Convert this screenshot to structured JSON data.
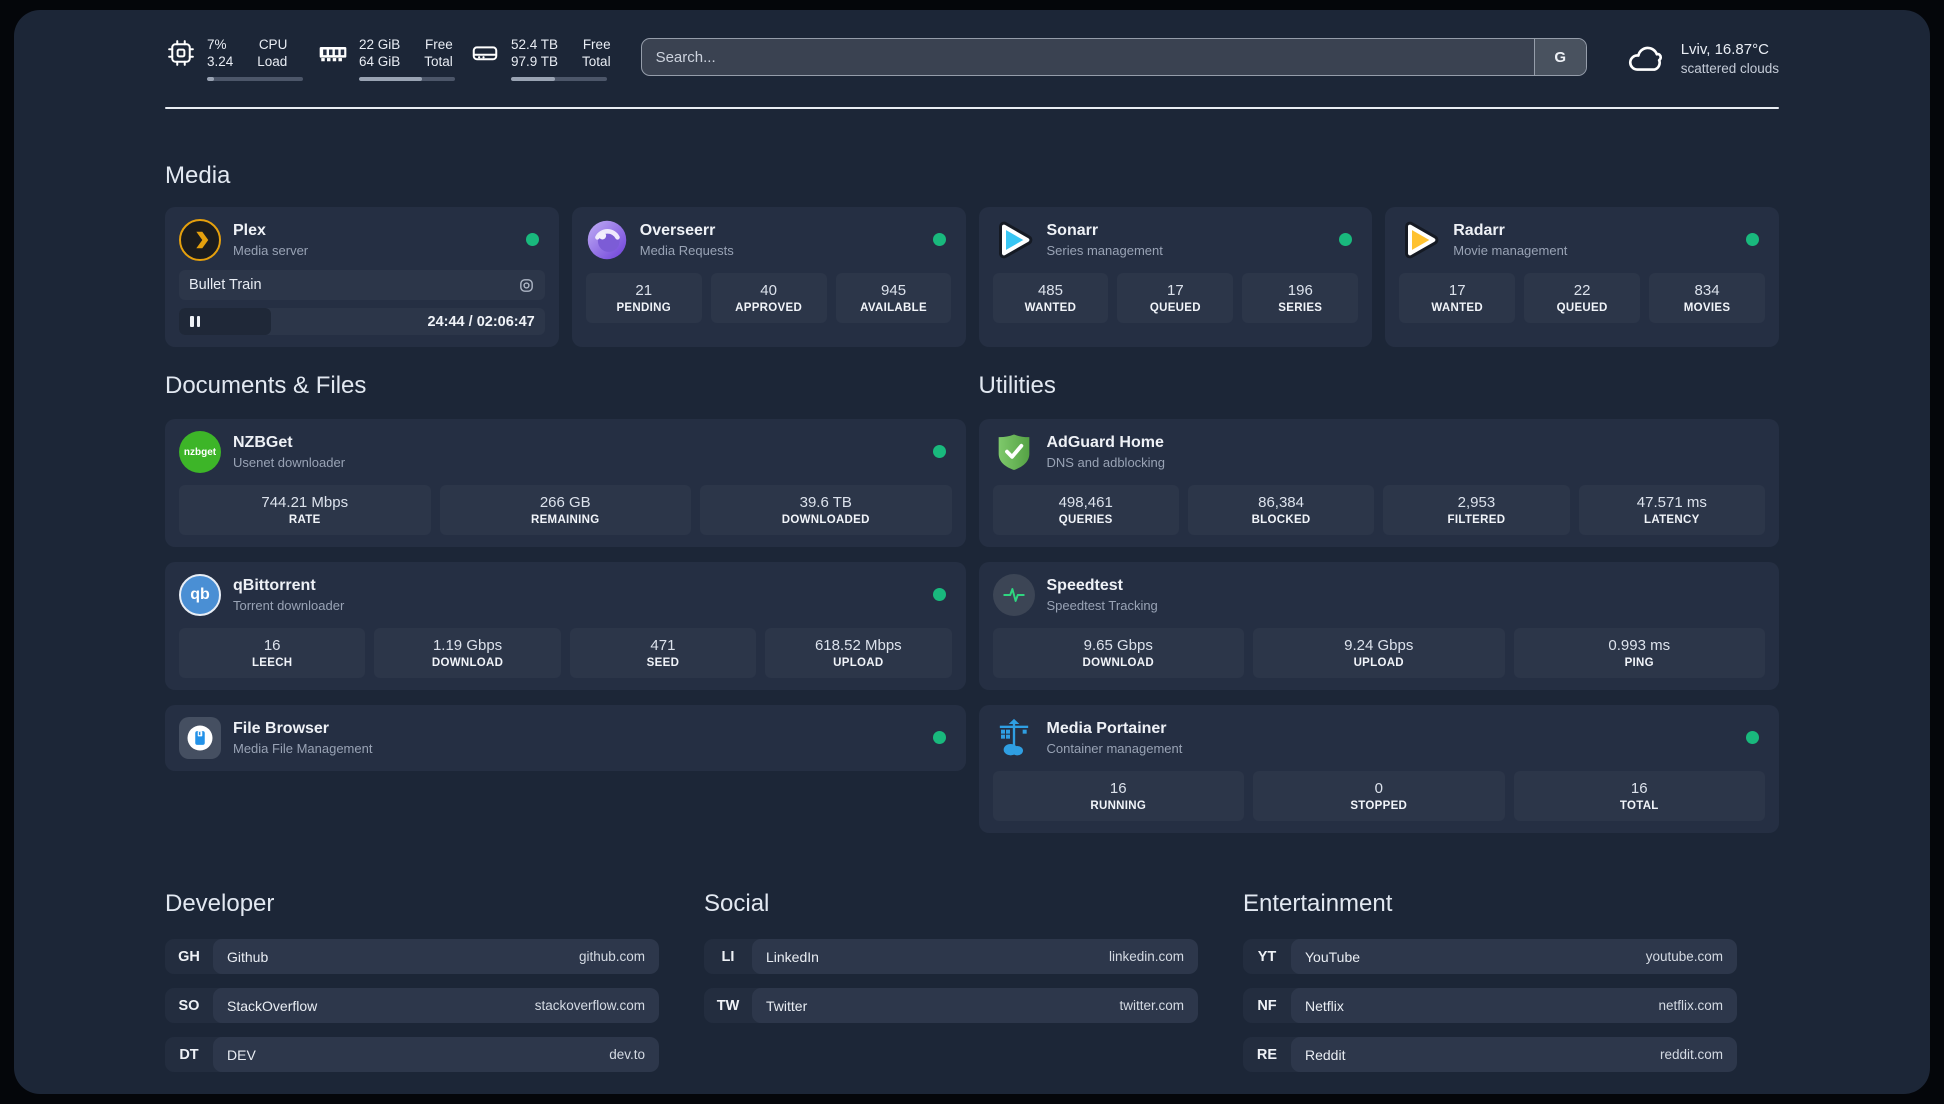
{
  "colors": {
    "status_green": "#19b97d",
    "plex_gold": "#e5a00d",
    "sonarr_blue": "#38c6f4",
    "radarr_gold": "#ffc230",
    "nzbget_green": "#3db528",
    "qbittorrent_blue": "#4a8fd4",
    "adguard_green": "#68b54d",
    "speedtest_green": "#2fd680",
    "portainer_blue": "#2f9fe3"
  },
  "header": {
    "stats": [
      {
        "icon": "cpu-icon",
        "rows": [
          {
            "value": "7%",
            "label": "CPU"
          },
          {
            "value": "3.24",
            "label": "Load"
          }
        ],
        "progress": 7
      },
      {
        "icon": "memory-icon",
        "rows": [
          {
            "value": "22 GiB",
            "label": "Free"
          },
          {
            "value": "64 GiB",
            "label": "Total"
          }
        ],
        "progress": 66
      },
      {
        "icon": "disk-icon",
        "rows": [
          {
            "value": "52.4 TB",
            "label": "Free"
          },
          {
            "value": "97.9 TB",
            "label": "Total"
          }
        ],
        "progress": 46
      }
    ],
    "search": {
      "placeholder": "Search...",
      "button_label": "G"
    },
    "weather": {
      "location": "Lviv, 16.87°C",
      "condition": "scattered clouds"
    }
  },
  "sections": {
    "media": "Media",
    "documents": "Documents & Files",
    "utilities": "Utilities",
    "developer": "Developer",
    "social": "Social",
    "entertainment": "Entertainment"
  },
  "apps": {
    "plex": {
      "name": "Plex",
      "desc": "Media server",
      "now_playing": "Bullet Train",
      "time": "24:44 / 02:06:47"
    },
    "overseerr": {
      "name": "Overseerr",
      "desc": "Media Requests",
      "stats": [
        {
          "value": "21",
          "label": "PENDING"
        },
        {
          "value": "40",
          "label": "APPROVED"
        },
        {
          "value": "945",
          "label": "AVAILABLE"
        }
      ]
    },
    "sonarr": {
      "name": "Sonarr",
      "desc": "Series management",
      "stats": [
        {
          "value": "485",
          "label": "WANTED"
        },
        {
          "value": "17",
          "label": "QUEUED"
        },
        {
          "value": "196",
          "label": "SERIES"
        }
      ]
    },
    "radarr": {
      "name": "Radarr",
      "desc": "Movie management",
      "stats": [
        {
          "value": "17",
          "label": "WANTED"
        },
        {
          "value": "22",
          "label": "QUEUED"
        },
        {
          "value": "834",
          "label": "MOVIES"
        }
      ]
    },
    "nzbget": {
      "name": "NZBGet",
      "desc": "Usenet downloader",
      "icon_text": "nzbget",
      "stats": [
        {
          "value": "744.21 Mbps",
          "label": "RATE"
        },
        {
          "value": "266 GB",
          "label": "REMAINING"
        },
        {
          "value": "39.6 TB",
          "label": "DOWNLOADED"
        }
      ]
    },
    "qbittorrent": {
      "name": "qBittorrent",
      "desc": "Torrent downloader",
      "icon_text": "qb",
      "stats": [
        {
          "value": "16",
          "label": "LEECH"
        },
        {
          "value": "1.19 Gbps",
          "label": "DOWNLOAD"
        },
        {
          "value": "471",
          "label": "SEED"
        },
        {
          "value": "618.52 Mbps",
          "label": "UPLOAD"
        }
      ]
    },
    "filebrowser": {
      "name": "File Browser",
      "desc": "Media File Management"
    },
    "adguard": {
      "name": "AdGuard Home",
      "desc": "DNS and adblocking",
      "stats": [
        {
          "value": "498,461",
          "label": "QUERIES"
        },
        {
          "value": "86,384",
          "label": "BLOCKED"
        },
        {
          "value": "2,953",
          "label": "FILTERED"
        },
        {
          "value": "47.571 ms",
          "label": "LATENCY"
        }
      ]
    },
    "speedtest": {
      "name": "Speedtest",
      "desc": "Speedtest Tracking",
      "stats": [
        {
          "value": "9.65 Gbps",
          "label": "DOWNLOAD"
        },
        {
          "value": "9.24 Gbps",
          "label": "UPLOAD"
        },
        {
          "value": "0.993 ms",
          "label": "PING"
        }
      ]
    },
    "portainer": {
      "name": "Media Portainer",
      "desc": "Container management",
      "stats": [
        {
          "value": "16",
          "label": "RUNNING"
        },
        {
          "value": "0",
          "label": "STOPPED"
        },
        {
          "value": "16",
          "label": "TOTAL"
        }
      ]
    }
  },
  "links": {
    "developer": [
      {
        "tag": "GH",
        "name": "Github",
        "url": "github.com"
      },
      {
        "tag": "SO",
        "name": "StackOverflow",
        "url": "stackoverflow.com"
      },
      {
        "tag": "DT",
        "name": "DEV",
        "url": "dev.to"
      }
    ],
    "social": [
      {
        "tag": "LI",
        "name": "LinkedIn",
        "url": "linkedin.com"
      },
      {
        "tag": "TW",
        "name": "Twitter",
        "url": "twitter.com"
      }
    ],
    "entertainment": [
      {
        "tag": "YT",
        "name": "YouTube",
        "url": "youtube.com"
      },
      {
        "tag": "NF",
        "name": "Netflix",
        "url": "netflix.com"
      },
      {
        "tag": "RE",
        "name": "Reddit",
        "url": "reddit.com"
      }
    ]
  }
}
